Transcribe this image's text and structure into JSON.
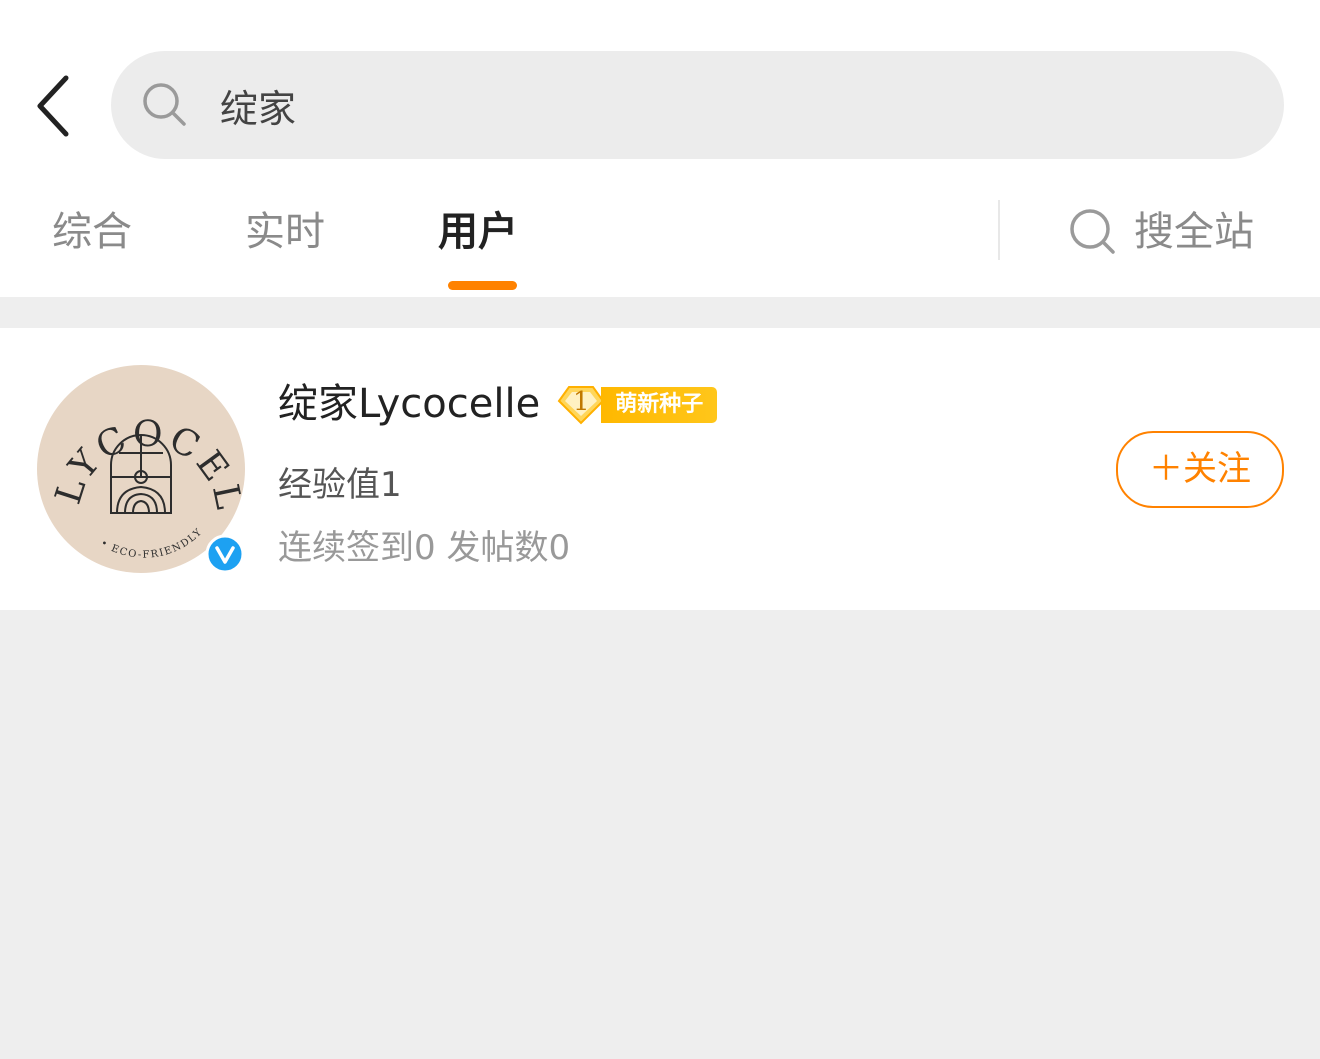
{
  "search": {
    "value": "绽家",
    "icon": "search-icon"
  },
  "header": {
    "back_icon": "chevron-left-icon"
  },
  "tabs": [
    {
      "label": "综合",
      "active": false
    },
    {
      "label": "实时",
      "active": false
    },
    {
      "label": "用户",
      "active": true
    }
  ],
  "search_all": {
    "label": "搜全站",
    "icon": "search-icon"
  },
  "users": [
    {
      "name": "绽家Lycocelle",
      "level": "1",
      "level_title": "萌新种子",
      "exp": "经验值1",
      "stats": "连续签到0 发帖数0",
      "verified": true,
      "follow_label": "＋关注",
      "avatar": {
        "brand": "LYCOCELLE",
        "tagline": "• ECO-FRIENDLY •"
      }
    }
  ],
  "colors": {
    "accent": "#ff8200",
    "badge_gold": "#ffb800",
    "verified_blue": "#1da1f2",
    "avatar_bg": "#e7d6c5",
    "page_bg": "#eeeeee"
  }
}
